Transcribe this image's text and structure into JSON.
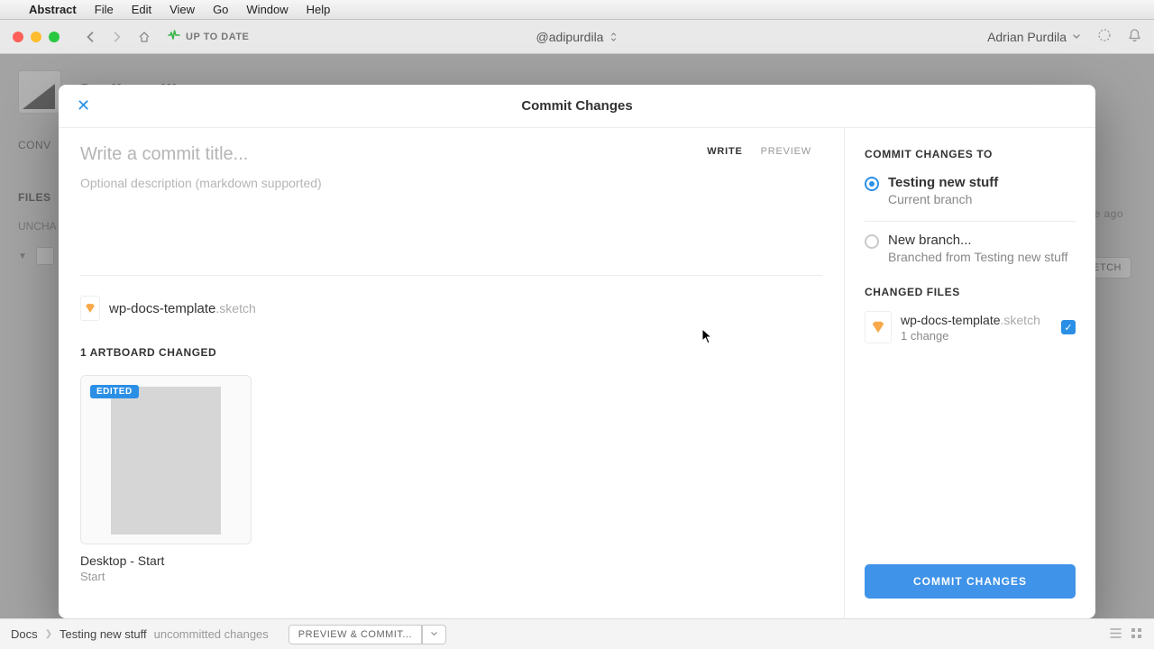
{
  "menubar": {
    "app": "Abstract",
    "file": "File",
    "edit": "Edit",
    "view": "View",
    "go": "Go",
    "window": "Window",
    "help": "Help"
  },
  "toolbar": {
    "status": "UP TO DATE",
    "handle": "@adipurdila",
    "user": "Adrian Purdila"
  },
  "background": {
    "handle": "@adipurdila",
    "tab_conv": "CONV",
    "section_files": "FILES",
    "sub_unchanged": "UNCHA",
    "time": "te ago",
    "side_btn": "ETCH"
  },
  "bottombar": {
    "crumb1": "Docs",
    "crumb2": "Testing new stuff",
    "status": "uncommitted changes",
    "btn": "PREVIEW & COMMIT..."
  },
  "modal": {
    "title": "Commit Changes",
    "title_placeholder": "Write a commit title...",
    "desc_placeholder": "Optional description (markdown supported)",
    "tab_write": "WRITE",
    "tab_preview": "PREVIEW",
    "file_name": "wp-docs-template",
    "file_ext": ".sketch",
    "artboard_header": "1 ARTBOARD CHANGED",
    "edited_badge": "EDITED",
    "artboard_title": "Desktop - Start",
    "artboard_sub": "Start"
  },
  "right": {
    "commit_to": "COMMIT CHANGES TO",
    "opt1_label": "Testing new stuff",
    "opt1_sub": "Current branch",
    "opt2_label": "New branch...",
    "opt2_sub": "Branched from Testing new stuff",
    "changed_header": "CHANGED FILES",
    "changed_name": "wp-docs-template",
    "changed_ext": ".sketch",
    "changed_sub": "1 change",
    "commit_btn": "COMMIT CHANGES"
  }
}
